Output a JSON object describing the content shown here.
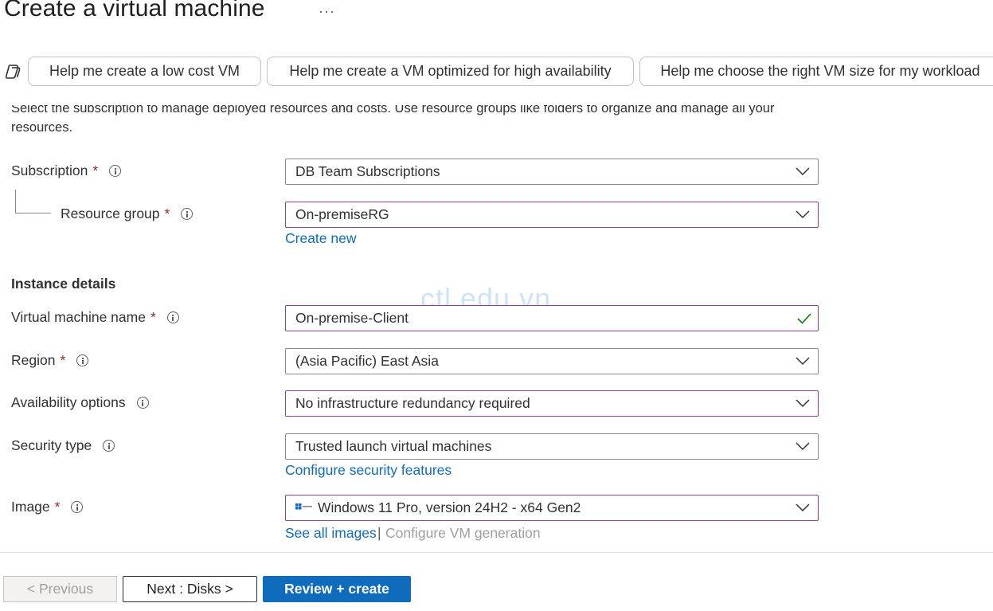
{
  "page": {
    "title": "Create a virtual machine",
    "more": "···"
  },
  "copilot": {
    "icon": "copilot-icon",
    "suggestions": [
      "Help me create a low cost VM",
      "Help me create a VM optimized for high availability",
      "Help me choose the right VM size for my workload"
    ]
  },
  "description": "Select the subscription to manage deployed resources and costs. Use resource groups like folders to organize and manage all your resources.",
  "project": {
    "subscription": {
      "label": "Subscription",
      "required": "*",
      "value": "DB Team Subscriptions"
    },
    "resource_group": {
      "label": "Resource group",
      "required": "*",
      "value": "On-premiseRG",
      "create_new": "Create new"
    }
  },
  "instance": {
    "heading": "Instance details",
    "vm_name": {
      "label": "Virtual machine name",
      "required": "*",
      "value": "On-premise-Client"
    },
    "region": {
      "label": "Region",
      "required": "*",
      "value": "(Asia Pacific) East Asia"
    },
    "availability": {
      "label": "Availability options",
      "value": "No infrastructure redundancy required"
    },
    "security": {
      "label": "Security type",
      "value": "Trusted launch virtual machines",
      "link": "Configure security features"
    },
    "image": {
      "label": "Image",
      "required": "*",
      "value": "Windows 11 Pro, version 24H2 - x64 Gen2",
      "see_all": "See all images",
      "separator": "|",
      "configure_gen": "Configure VM generation"
    }
  },
  "watermark": "ctl.edu.vn",
  "footer": {
    "previous": "< Previous",
    "next": "Next : Disks >",
    "review": "Review + create"
  },
  "colors": {
    "accent": "#0f6cbd",
    "required": "#a4262c",
    "focus_border": "#8a3fa0",
    "valid_check": "#107c10"
  }
}
